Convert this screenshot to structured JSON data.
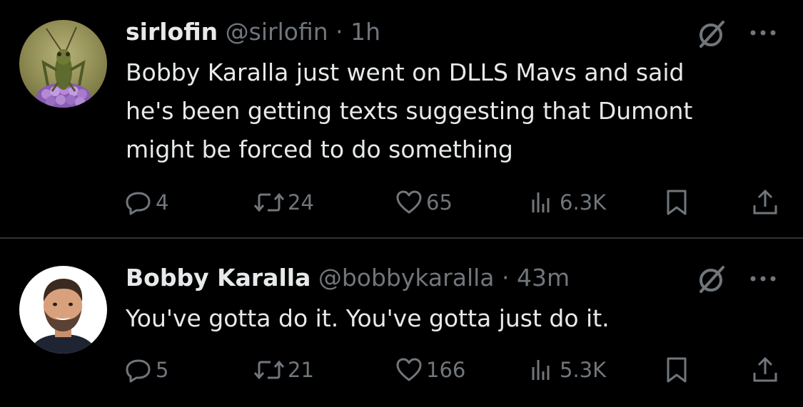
{
  "tweets": [
    {
      "display_name": "sirlofin",
      "handle": "@sirlofin",
      "separator": "·",
      "time": "1h",
      "avatar_icon": "grasshopper-on-flower-photo",
      "text": "Bobby Karalla just went on DLLS Mavs and said\nhe's been getting texts suggesting that Dumont\nmight be forced to do something",
      "replies": "4",
      "retweets": "24",
      "likes": "65",
      "views": "6.3K"
    },
    {
      "display_name": "Bobby Karalla",
      "handle": "@bobbykaralla",
      "separator": "·",
      "time": "43m",
      "avatar_icon": "smiling-man-photo",
      "text": "You've gotta do it. You've gotta just do it.",
      "replies": "5",
      "retweets": "21",
      "likes": "166",
      "views": "5.3K"
    }
  ],
  "icons": {
    "grok": "grok-icon",
    "more": "more-icon",
    "reply": "reply-icon",
    "retweet": "retweet-icon",
    "like": "heart-icon",
    "views": "views-icon",
    "bookmark": "bookmark-icon",
    "share": "share-icon"
  },
  "colors": {
    "background": "#000000",
    "primary_text": "#e7e9ea",
    "secondary_text": "#71767b",
    "divider": "#2f3336"
  }
}
